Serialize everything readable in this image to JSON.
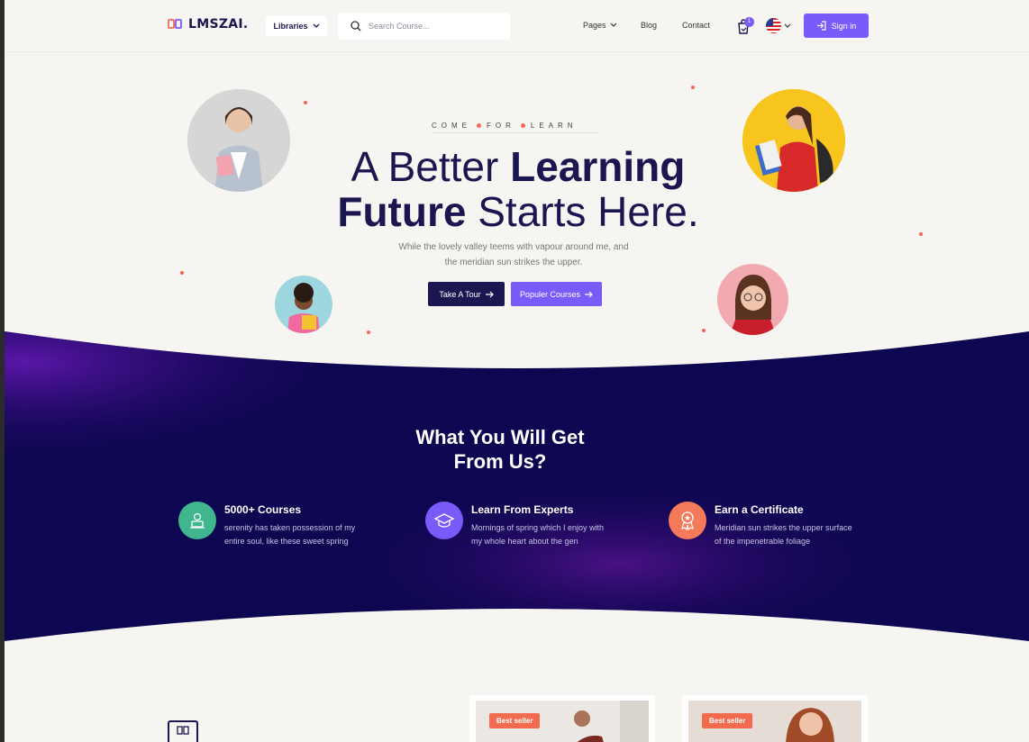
{
  "header": {
    "logo_text": "LMSZAI.",
    "libraries_label": "Libraries",
    "search_placeholder": "Search Course...",
    "nav": {
      "pages": "Pages",
      "blog": "Blog",
      "contact": "Contact"
    },
    "cart_count": "1",
    "signin_label": "Sign in"
  },
  "hero": {
    "kicker": [
      "COME",
      "FOR",
      "LEARN"
    ],
    "title_line1_light": "A Better ",
    "title_line1_bold": "Learning",
    "title_line2_bold": "Future",
    "title_line2_light": " Starts Here.",
    "subtitle_line1": "While the lovely valley teems with vapour around me, and",
    "subtitle_line2": "the meridian sun strikes the upper.",
    "btn_tour": "Take A Tour",
    "btn_courses": "Populer Courses"
  },
  "features": {
    "title_line1": "What You Will Get",
    "title_line2": "From Us?",
    "items": [
      {
        "title": "5000+ Courses",
        "desc_line1": "serenity has taken possession of my",
        "desc_line2": "entire soul, like these sweet spring",
        "color": "#3fb68e"
      },
      {
        "title": "Learn From Experts",
        "desc_line1": "Mornings of spring which I enjoy with",
        "desc_line2": "my whole heart about the gen",
        "color": "#7a5af8"
      },
      {
        "title": "Earn a Certificate",
        "desc_line1": "Meridian sun strikes the upper surface",
        "desc_line2": "of the impenetrable foliage",
        "color": "#f57a5a"
      }
    ]
  },
  "courses": [
    {
      "badge": "Best seller"
    },
    {
      "badge": "Best seller"
    }
  ],
  "colors": {
    "primary": "#1b1650",
    "accent": "#7a5af8",
    "coral": "#f26b4f"
  }
}
